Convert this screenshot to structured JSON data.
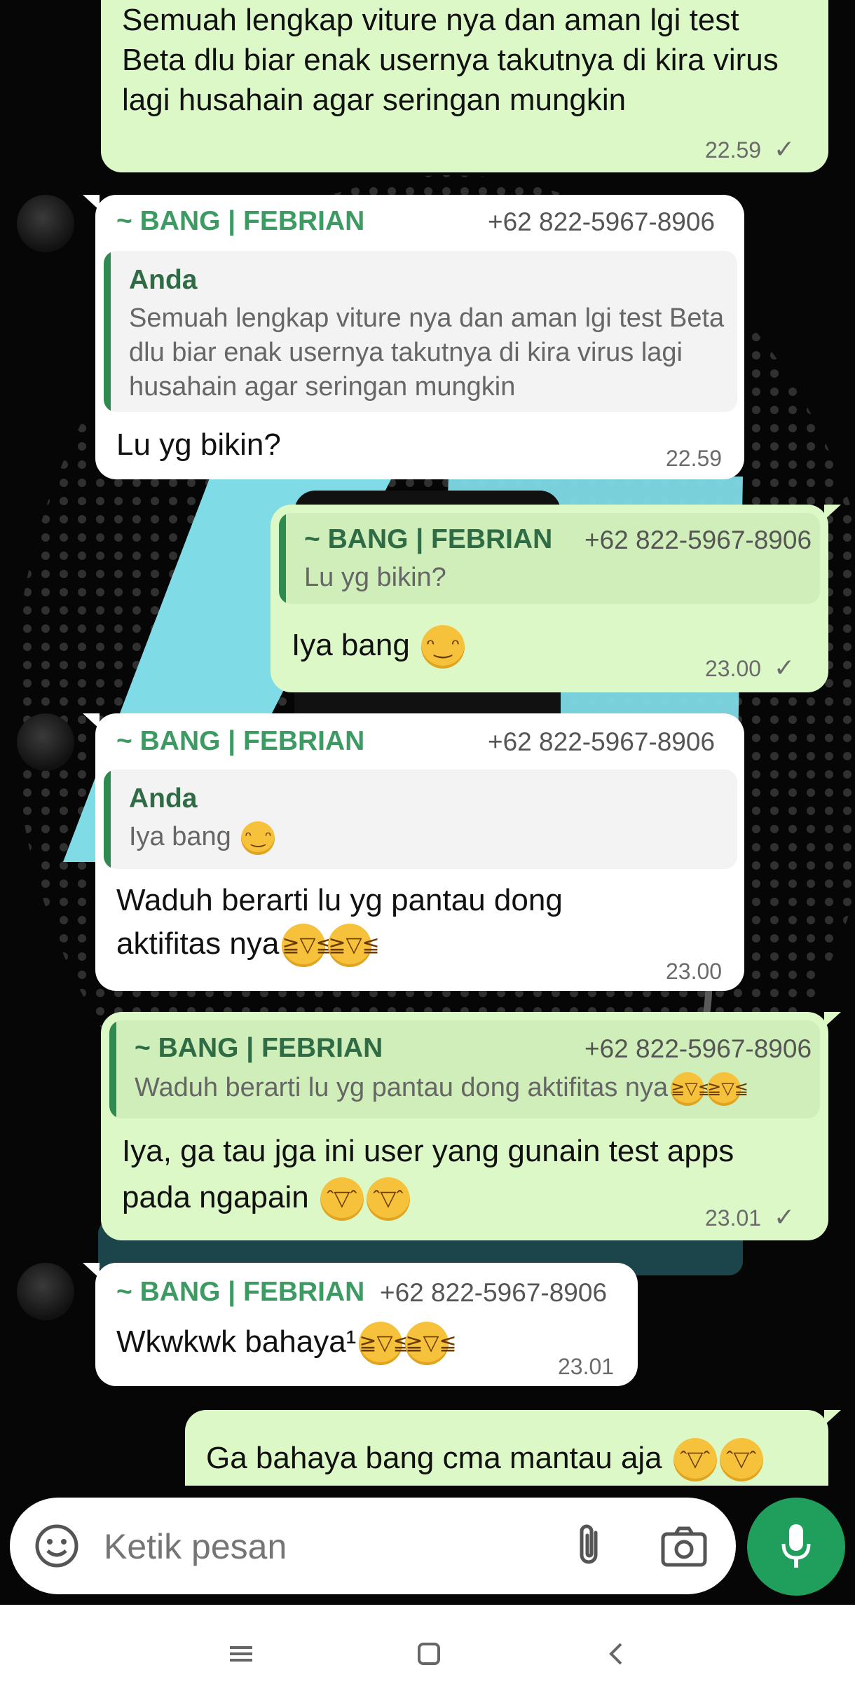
{
  "messages": [
    {
      "text": "Semuah lengkap viture nya dan aman lgi test Beta dlu biar enak usernya takutnya di kira virus lagi husahain agar seringan mungkin",
      "time": "22.59",
      "check": "✓"
    },
    {
      "sender": "~ BANG | FEBRIAN",
      "phone": "+62 822-5967-8906",
      "quote_sender": "Anda",
      "quote_text": "Semuah lengkap viture nya dan aman lgi test Beta dlu biar enak usernya takutnya di kira virus lagi husahain agar seringan mungkin",
      "text": "Lu yg bikin?",
      "time": "22.59"
    },
    {
      "quote_sender": "~ BANG | FEBRIAN",
      "quote_phone": "+62 822-5967-8906",
      "quote_text": "Lu yg bikin?",
      "text": "Iya bang",
      "time": "23.00",
      "check": "✓"
    },
    {
      "sender": "~ BANG | FEBRIAN",
      "phone": "+62 822-5967-8906",
      "quote_sender": "Anda",
      "quote_text": "Iya bang",
      "text_line1": "Waduh berarti lu yg pantau dong",
      "text_line2": "aktifitas nya",
      "time": "23.00"
    },
    {
      "quote_sender": "~ BANG | FEBRIAN",
      "quote_phone": "+62 822-5967-8906",
      "quote_text": "Waduh berarti lu yg pantau dong aktifitas nya",
      "text_line1": "Iya, ga tau jga ini user yang gunain test apps",
      "text_line2": "pada ngapain",
      "time": "23.01",
      "check": "✓"
    },
    {
      "sender": "~ BANG | FEBRIAN",
      "phone": "+62 822-5967-8906",
      "text": "Wkwkwk bahaya¹",
      "time": "23.01"
    },
    {
      "text": "Ga bahaya bang cma mantau aja"
    }
  ],
  "composer": {
    "placeholder": "Ketik pesan"
  },
  "icons": {
    "emoji": "emoji-icon",
    "attach": "paperclip-icon",
    "camera": "camera-icon",
    "mic": "mic-icon",
    "menu": "recent-apps-icon",
    "home": "home-icon",
    "back": "back-icon"
  },
  "colors": {
    "outgoing": "#dcf8c6",
    "incoming": "#ffffff",
    "accent": "#1f9e5c",
    "sender_name": "#3d9a62"
  }
}
